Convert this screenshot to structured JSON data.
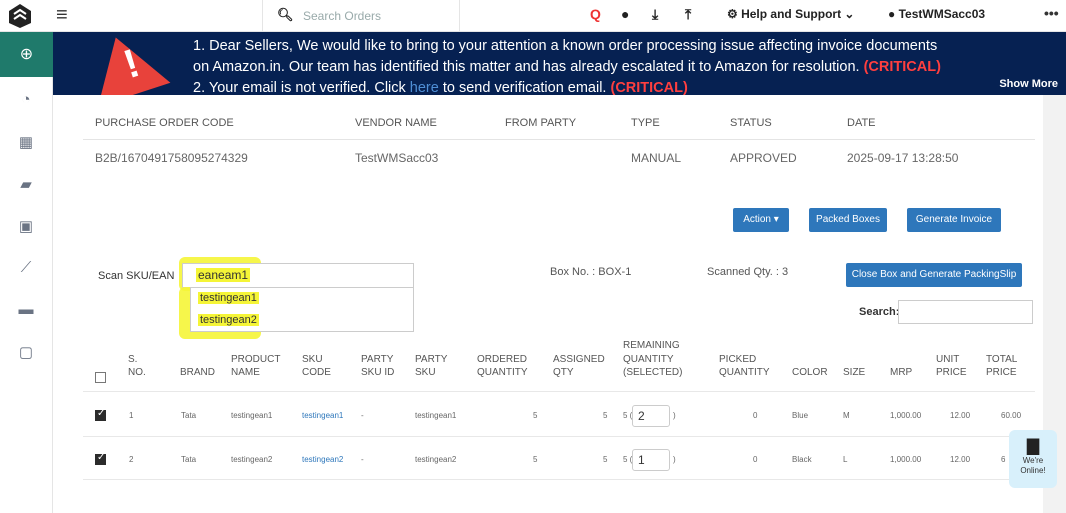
{
  "topbar": {
    "search_placeholder": "Search Orders",
    "help_label": "Help and Support",
    "user_label": "TestWMSacc03",
    "more_label": "•••"
  },
  "banner": {
    "line1": "1. Dear Sellers, We would like to bring to your attention a known order processing issue affecting invoice documents",
    "line2_a": "on Amazon.in. Our team has identified this matter and has already escalated it to Amazon for resolution.",
    "line2_crit": "(CRITICAL)",
    "line3_a": "2. Your email is not verified. Click",
    "line3_link": "here",
    "line3_b": "to send verification email.",
    "line3_crit": "(CRITICAL)",
    "show_more": "Show More"
  },
  "po": {
    "headers": [
      "PURCHASE ORDER CODE",
      "VENDOR NAME",
      "FROM PARTY",
      "TYPE",
      "STATUS",
      "DATE"
    ],
    "code": "B2B/1670491758095274329",
    "vendor": "TestWMSacc03",
    "from_party": "",
    "type": "MANUAL",
    "status": "APPROVED",
    "date": "2025-09-17 13:28:50"
  },
  "actions": {
    "action": "Action ▾",
    "packed": "Packed Boxes",
    "invoice": "Generate Invoice",
    "close_box": "Close Box and Generate PackingSlip"
  },
  "scan": {
    "label": "Scan SKU/EAN",
    "value": "eaneam1",
    "suggestions": [
      "testingean1",
      "testingean2"
    ],
    "box_label": "Box No. : BOX-1",
    "scanned_label": "Scanned Qty. : 3",
    "search_label": "Search:"
  },
  "table": {
    "headers": [
      {
        "l1": "",
        "l2": "S.",
        "l3": "NO."
      },
      {
        "l1": "",
        "l2": "",
        "l3": "BRAND"
      },
      {
        "l1": "",
        "l2": "PRODUCT",
        "l3": "NAME"
      },
      {
        "l1": "",
        "l2": "SKU",
        "l3": "CODE"
      },
      {
        "l1": "",
        "l2": "PARTY",
        "l3": "SKU ID"
      },
      {
        "l1": "",
        "l2": "PARTY",
        "l3": "SKU"
      },
      {
        "l1": "",
        "l2": "ORDERED",
        "l3": "QUANTITY"
      },
      {
        "l1": "",
        "l2": "ASSIGNED",
        "l3": "QTY"
      },
      {
        "l1": "REMAINING",
        "l2": "QUANTITY",
        "l3": "(SELECTED)"
      },
      {
        "l1": "",
        "l2": "PICKED",
        "l3": "QUANTITY"
      },
      {
        "l1": "",
        "l2": "",
        "l3": "COLOR"
      },
      {
        "l1": "",
        "l2": "",
        "l3": "SIZE"
      },
      {
        "l1": "",
        "l2": "",
        "l3": "MRP"
      },
      {
        "l1": "",
        "l2": "UNIT",
        "l3": "PRICE"
      },
      {
        "l1": "",
        "l2": "TOTAL",
        "l3": "PRICE"
      }
    ],
    "rows": [
      {
        "sno": "1",
        "brand": "Tata",
        "name": "testingean1",
        "sku": "testingean1",
        "party_sku_id": "-",
        "party_sku": "testingean1",
        "ordered": "5",
        "assigned": "5",
        "rem_prefix": "5 (",
        "rem_value": "2",
        "rem_suffix": ")",
        "picked": "0",
        "color": "Blue",
        "size": "M",
        "mrp": "1,000.00",
        "unit": "12.00",
        "total": "60.00"
      },
      {
        "sno": "2",
        "brand": "Tata",
        "name": "testingean2",
        "sku": "testingean2",
        "party_sku_id": "-",
        "party_sku": "testingean2",
        "ordered": "5",
        "assigned": "5",
        "rem_prefix": "5 (",
        "rem_value": "1",
        "rem_suffix": ")",
        "picked": "0",
        "color": "Black",
        "size": "L",
        "mrp": "1,000.00",
        "unit": "12.00",
        "total": "6"
      }
    ]
  },
  "chat": {
    "line1": "We're",
    "line2": "Online!"
  }
}
